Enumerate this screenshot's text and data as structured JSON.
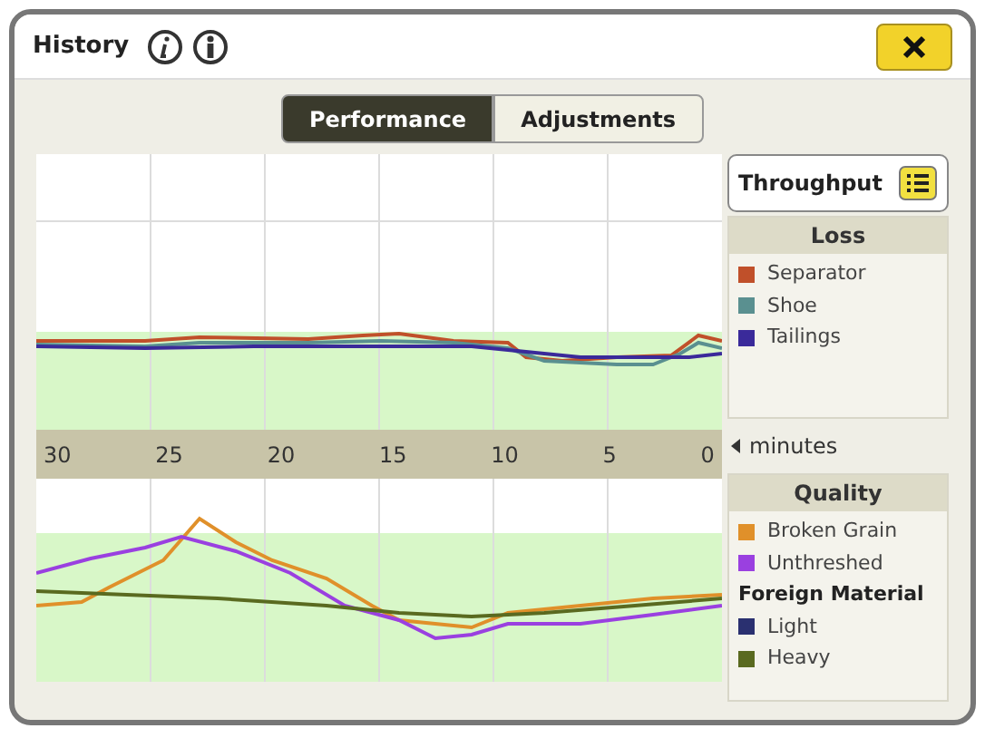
{
  "window": {
    "title": "History"
  },
  "tabs": [
    {
      "label": "Performance",
      "selected": true
    },
    {
      "label": "Adjustments",
      "selected": false
    }
  ],
  "selector": {
    "label": "Throughput"
  },
  "axis": {
    "ticks": [
      "30",
      "25",
      "20",
      "15",
      "10",
      "5",
      "0"
    ],
    "unit": "minutes"
  },
  "loss": {
    "title": "Loss",
    "items": [
      {
        "kind": "item",
        "label": "Separator",
        "color": "#c0502a"
      },
      {
        "kind": "item",
        "label": "Shoe",
        "color": "#5a9090"
      },
      {
        "kind": "item",
        "label": "Tailings",
        "color": "#3a2a9a"
      }
    ]
  },
  "quality": {
    "title": "Quality",
    "items": [
      {
        "kind": "item",
        "label": "Broken Grain",
        "color": "#e0902a"
      },
      {
        "kind": "item",
        "label": "Unthreshed",
        "color": "#9a40e0"
      },
      {
        "kind": "heading",
        "label": "Foreign Material"
      },
      {
        "kind": "item",
        "label": "Light",
        "color": "#2a3070"
      },
      {
        "kind": "item",
        "label": "Heavy",
        "color": "#5a6a20"
      }
    ]
  }
}
